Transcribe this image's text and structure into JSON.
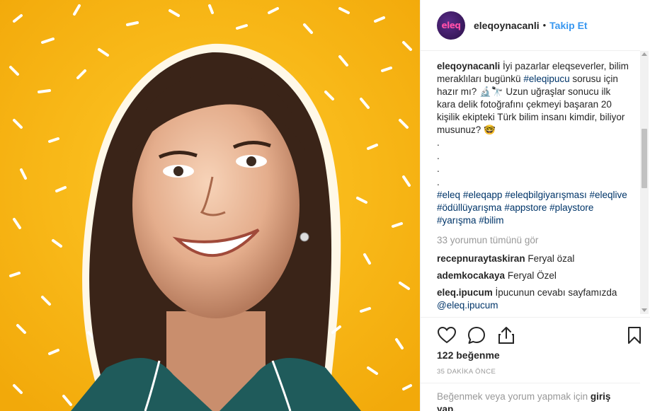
{
  "post": {
    "username": "eleqoynacanli",
    "separator": "•",
    "follow_label": "Takip Et",
    "avatar_text": "eleq"
  },
  "caption": {
    "username": "eleqoynacanli",
    "text1": " İyi pazarlar eleqseverler, bilim meraklıları bugünkü ",
    "hashtag1": "#eleqipucu",
    "text2": " sorusu için hazır mı? 🔬🔭 Uzun uğraşlar sonucu ilk kara delik fotoğrafını çekmeyi başaran 20 kişilik ekipteki Türk bilim insanı kimdir, biliyor musunuz? 🤓",
    "dots": [
      ".",
      ".",
      ".",
      "."
    ],
    "hashtags": [
      "#eleq",
      "#eleqapp",
      "#eleqbilgiyarışması",
      "#eleqlive",
      "#ödüllüyarışma",
      "#appstore",
      "#playstore",
      "#yarışma",
      "#bilim"
    ]
  },
  "view_all": "33 yorumun tümünü gör",
  "comments": [
    {
      "user": "recepnuraytaskiran",
      "text": "Feryal özal"
    },
    {
      "user": "ademkocakaya",
      "text": "Feryal Özel"
    },
    {
      "user": "eleq.ipucum",
      "text": "İpucunun cevabı sayfamızda ",
      "mention": "@eleq.ipucum"
    }
  ],
  "likes": "122 beğenme",
  "time": "35 DAKİKA ÖNCE",
  "add_comment": {
    "text": "Beğenmek veya yorum yapmak için ",
    "link": "giriş yap."
  },
  "icons": {
    "like": "heart-icon",
    "comment": "comment-icon",
    "share": "share-icon",
    "save": "bookmark-icon"
  },
  "colors": {
    "background_yellow": "#f6b60e",
    "link_blue": "#3897f0",
    "hashtag": "#003569"
  }
}
